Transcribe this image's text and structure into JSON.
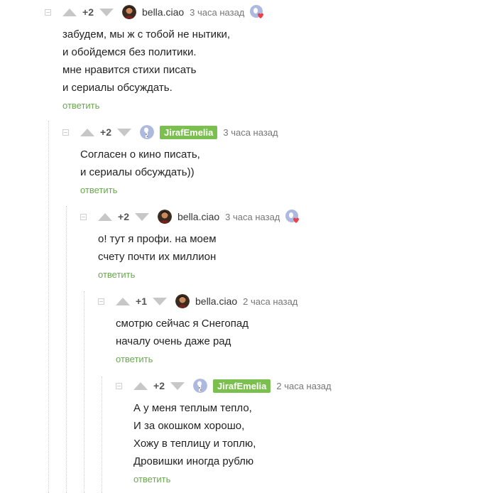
{
  "comments": [
    {
      "rating": "+2",
      "author": "bella.ciao",
      "time": "3 часа назад",
      "lines": [
        "забудем, мы ж с тобой не нытики,",
        "и обойдемся без политики.",
        "мне нравится стихи писать",
        "и сериалы обсуждать."
      ],
      "reply": "ответить"
    },
    {
      "rating": "+2",
      "author": "JirafEmelia",
      "time": "3 часа назад",
      "lines": [
        "Согласен о кино писать,",
        "и сериалы обсуждать))"
      ],
      "reply": "ответить"
    },
    {
      "rating": "+2",
      "author": "bella.ciao",
      "time": "3 часа назад",
      "lines": [
        "о! тут я профи. на моем",
        "счету почти их миллион"
      ],
      "reply": "ответить"
    },
    {
      "rating": "+1",
      "author": "bella.ciao",
      "time": "2 часа назад",
      "lines": [
        "смотрю сейчас я Снегопад",
        "началу очень даже рад"
      ],
      "reply": "ответить"
    },
    {
      "rating": "+2",
      "author": "JirafEmelia",
      "time": "2 часа назад",
      "lines": [
        "А у меня теплым тепло,",
        "И за окошком хорошо,",
        "Хожу в теплицу и топлю,",
        "Дровишки иногда рублю"
      ],
      "reply": "ответить"
    }
  ],
  "colors": {
    "accent": "#7bc04f",
    "reply_link": "#6aa84f",
    "arrow": "#c7c7c7"
  }
}
